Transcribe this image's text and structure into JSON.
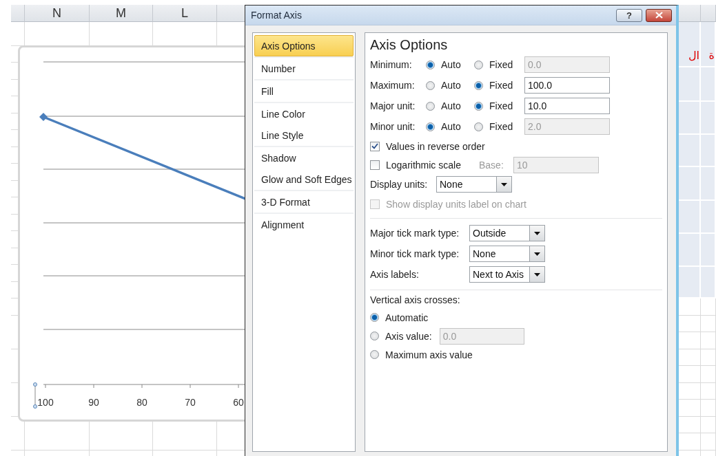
{
  "sheet": {
    "column_headers": [
      "N",
      "M",
      "L"
    ],
    "right_cells": [
      "ة",
      "ال"
    ]
  },
  "chart": {
    "axis_labels": [
      "100",
      "90",
      "80",
      "70",
      "60"
    ]
  },
  "dialog": {
    "title": "Format Axis",
    "help": "?",
    "nav_groups": [
      {
        "items": [
          {
            "label": "Axis Options",
            "selected": true
          }
        ]
      },
      {
        "items": [
          {
            "label": "Number",
            "selected": false
          }
        ]
      },
      {
        "items": [
          {
            "label": "Fill",
            "selected": false
          }
        ]
      },
      {
        "items": [
          {
            "label": "Line Color",
            "selected": false
          },
          {
            "label": "Line Style",
            "selected": false
          }
        ]
      },
      {
        "items": [
          {
            "label": "Shadow",
            "selected": false
          },
          {
            "label": "Glow and Soft Edges",
            "selected": false
          }
        ]
      },
      {
        "items": [
          {
            "label": "3-D Format",
            "selected": false
          }
        ]
      },
      {
        "items": [
          {
            "label": "Alignment",
            "selected": false
          }
        ]
      }
    ],
    "panel": {
      "heading": "Axis Options",
      "bounds": [
        {
          "label": "Minimum:",
          "options": [
            {
              "label": "Auto",
              "selected": true
            },
            {
              "label": "Fixed",
              "selected": false
            }
          ],
          "value": "0.0",
          "disabled": true
        },
        {
          "label": "Maximum:",
          "options": [
            {
              "label": "Auto",
              "selected": false
            },
            {
              "label": "Fixed",
              "selected": true
            }
          ],
          "value": "100.0",
          "disabled": false
        },
        {
          "label": "Major unit:",
          "options": [
            {
              "label": "Auto",
              "selected": false
            },
            {
              "label": "Fixed",
              "selected": true
            }
          ],
          "value": "10.0",
          "disabled": false
        },
        {
          "label": "Minor unit:",
          "options": [
            {
              "label": "Auto",
              "selected": true
            },
            {
              "label": "Fixed",
              "selected": false
            }
          ],
          "value": "2.0",
          "disabled": true
        }
      ],
      "reverse": {
        "label": "Values in reverse order",
        "checked": true
      },
      "log": {
        "label": "Logarithmic scale",
        "checked": false,
        "base": {
          "label": "Base:",
          "value": "10",
          "disabled": true
        }
      },
      "display_units": {
        "label": "Display units:",
        "value": "None"
      },
      "show_units_label": {
        "label": "Show display units label on chart",
        "checked": false,
        "disabled": true
      },
      "dropdowns": [
        {
          "label": "Major tick mark type:",
          "value": "Outside"
        },
        {
          "label": "Minor tick mark type:",
          "value": "None"
        },
        {
          "label": "Axis labels:",
          "value": "Next to Axis"
        }
      ],
      "crosses": {
        "label": "Vertical axis crosses:",
        "options": [
          {
            "label": "Automatic",
            "selected": true
          },
          {
            "label": "Axis value:",
            "selected": false,
            "value": "0.0",
            "disabled": true
          },
          {
            "label": "Maximum axis value",
            "selected": false
          }
        ]
      }
    }
  }
}
